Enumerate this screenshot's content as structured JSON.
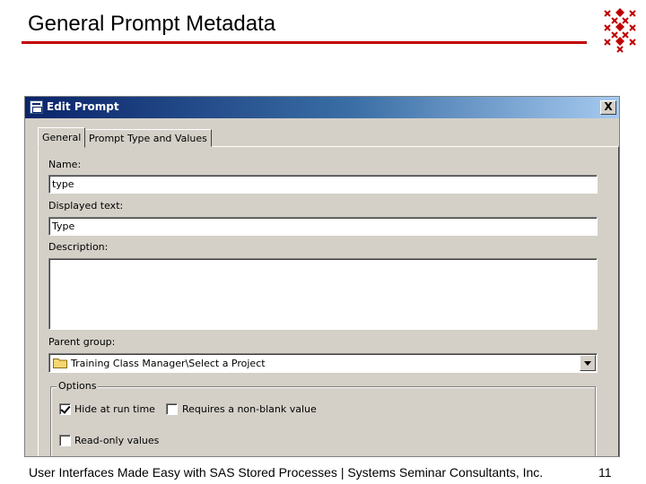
{
  "slide": {
    "title": "General Prompt Metadata",
    "footer": "User Interfaces Made Easy with SAS Stored Processes | Systems Seminar Consultants, Inc.",
    "page_number": "11"
  },
  "dialog": {
    "title": "Edit Prompt",
    "close_label": "X",
    "tabs": [
      {
        "label": "General",
        "active": true
      },
      {
        "label": "Prompt Type and Values",
        "active": false
      }
    ],
    "fields": {
      "name_label": "Name:",
      "name_value": "type",
      "displayed_text_label": "Displayed text:",
      "displayed_text_value": "Type",
      "description_label": "Description:",
      "description_value": "",
      "parent_group_label": "Parent group:",
      "parent_group_value": "Training Class Manager\\Select a Project"
    },
    "options": {
      "legend": "Options",
      "hide_at_run_time": {
        "label": "Hide at run time",
        "checked": true
      },
      "requires_non_blank": {
        "label": "Requires a non-blank value",
        "checked": false
      },
      "read_only": {
        "label": "Read-only values",
        "checked": false
      }
    }
  },
  "colors": {
    "title_rule": "#c00000",
    "logo": "#c00000",
    "dialog_bg": "#d4d0c8",
    "titlebar_start": "#0a246a",
    "titlebar_end": "#a6caf0"
  },
  "icons": [
    "company-logo-icon",
    "app-icon",
    "close-icon",
    "folder-icon",
    "chevron-down-icon",
    "checkmark-icon"
  ]
}
